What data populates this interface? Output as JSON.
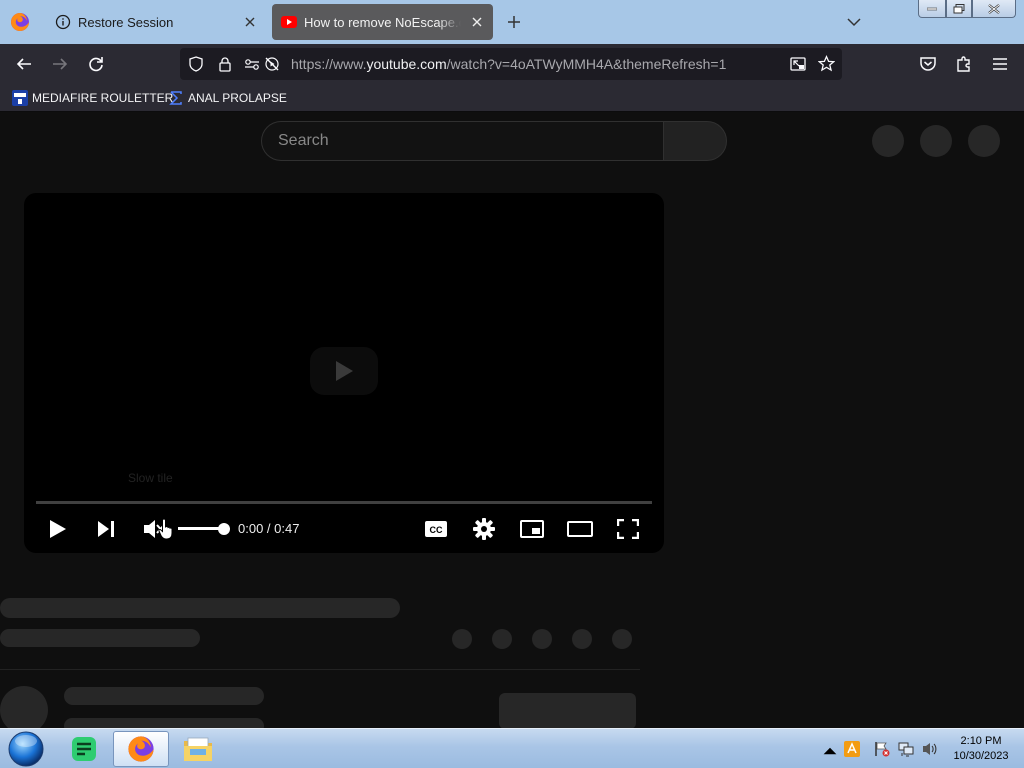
{
  "browser": {
    "tabs": [
      {
        "title": "Restore Session",
        "active": false
      },
      {
        "title": "How to remove NoEscape.exe | ",
        "active": true
      }
    ],
    "url": {
      "prefix": "https://www.",
      "domain": "youtube.com",
      "path": "/watch?v=4oATWyMMH4A&themeRefresh=1"
    },
    "bookmarks": [
      {
        "label": "MEDIAFIRE ROULETTER"
      },
      {
        "label": "ANAL PROLAPSE"
      }
    ]
  },
  "page": {
    "search_placeholder": "Search",
    "player": {
      "time": "0:00 / 0:47",
      "ghost_text": "Slow tile",
      "progress": 0,
      "volume": 0.9,
      "muted": true
    }
  },
  "taskbar": {
    "apps": [
      {
        "icon": "notes-app-icon"
      },
      {
        "icon": "firefox-icon",
        "active": true
      },
      {
        "icon": "file-explorer-icon"
      }
    ],
    "clock": {
      "time": "2:10 PM",
      "date": "10/30/2023"
    }
  },
  "colors": {
    "tabstrip": "#a7c7e7",
    "toolbar": "#2b2a33",
    "page_bg": "#0f0f0f",
    "youtube_red": "#ff0000"
  }
}
